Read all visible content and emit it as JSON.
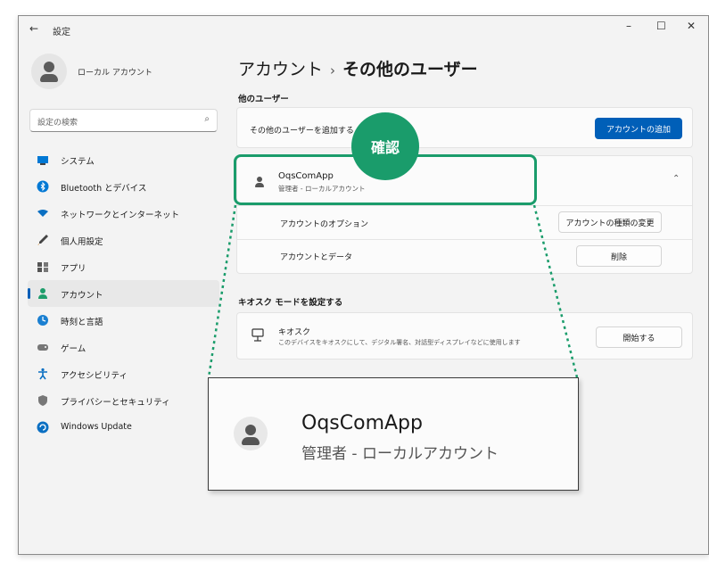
{
  "window": {
    "title": "設定",
    "back": "←",
    "minimize": "–",
    "maximize": "☐",
    "close": "✕"
  },
  "profile": {
    "name": "ローカル アカウント"
  },
  "search": {
    "placeholder": "設定の検索",
    "icon": "⌕"
  },
  "nav": [
    {
      "label": "システム",
      "icon": "system-icon"
    },
    {
      "label": "Bluetooth とデバイス",
      "icon": "bluetooth-icon"
    },
    {
      "label": "ネットワークとインターネット",
      "icon": "network-icon"
    },
    {
      "label": "個人用設定",
      "icon": "personalization-icon"
    },
    {
      "label": "アプリ",
      "icon": "apps-icon"
    },
    {
      "label": "アカウント",
      "icon": "accounts-icon",
      "active": true
    },
    {
      "label": "時刻と言語",
      "icon": "time-language-icon"
    },
    {
      "label": "ゲーム",
      "icon": "gaming-icon"
    },
    {
      "label": "アクセシビリティ",
      "icon": "accessibility-icon"
    },
    {
      "label": "プライバシーとセキュリティ",
      "icon": "privacy-icon"
    },
    {
      "label": "Windows Update",
      "icon": "windows-update-icon"
    }
  ],
  "breadcrumb": {
    "parent": "アカウント",
    "separator": "›",
    "current": "その他のユーザー"
  },
  "other_users": {
    "title": "他のユーザー",
    "add_label": "その他のユーザーを追加する",
    "add_button": "アカウントの追加",
    "user": {
      "name": "OqsComApp",
      "role": "管理者 - ローカルアカウント"
    },
    "options_label": "アカウントのオプション",
    "change_type_button": "アカウントの種類の変更",
    "data_label": "アカウントとデータ",
    "delete_button": "削除"
  },
  "kiosk": {
    "title": "キオスク モードを設定する",
    "name": "キオスク",
    "description": "このデバイスをキオスクにして、デジタル署名、対話型ディスプレイなどに使用します",
    "button": "開始する"
  },
  "callout": {
    "label": "確認"
  },
  "zoom": {
    "name": "OqsComApp",
    "role": "管理者 - ローカルアカウント"
  },
  "colors": {
    "accent": "#005fb8",
    "highlight": "#1a9c6b"
  }
}
